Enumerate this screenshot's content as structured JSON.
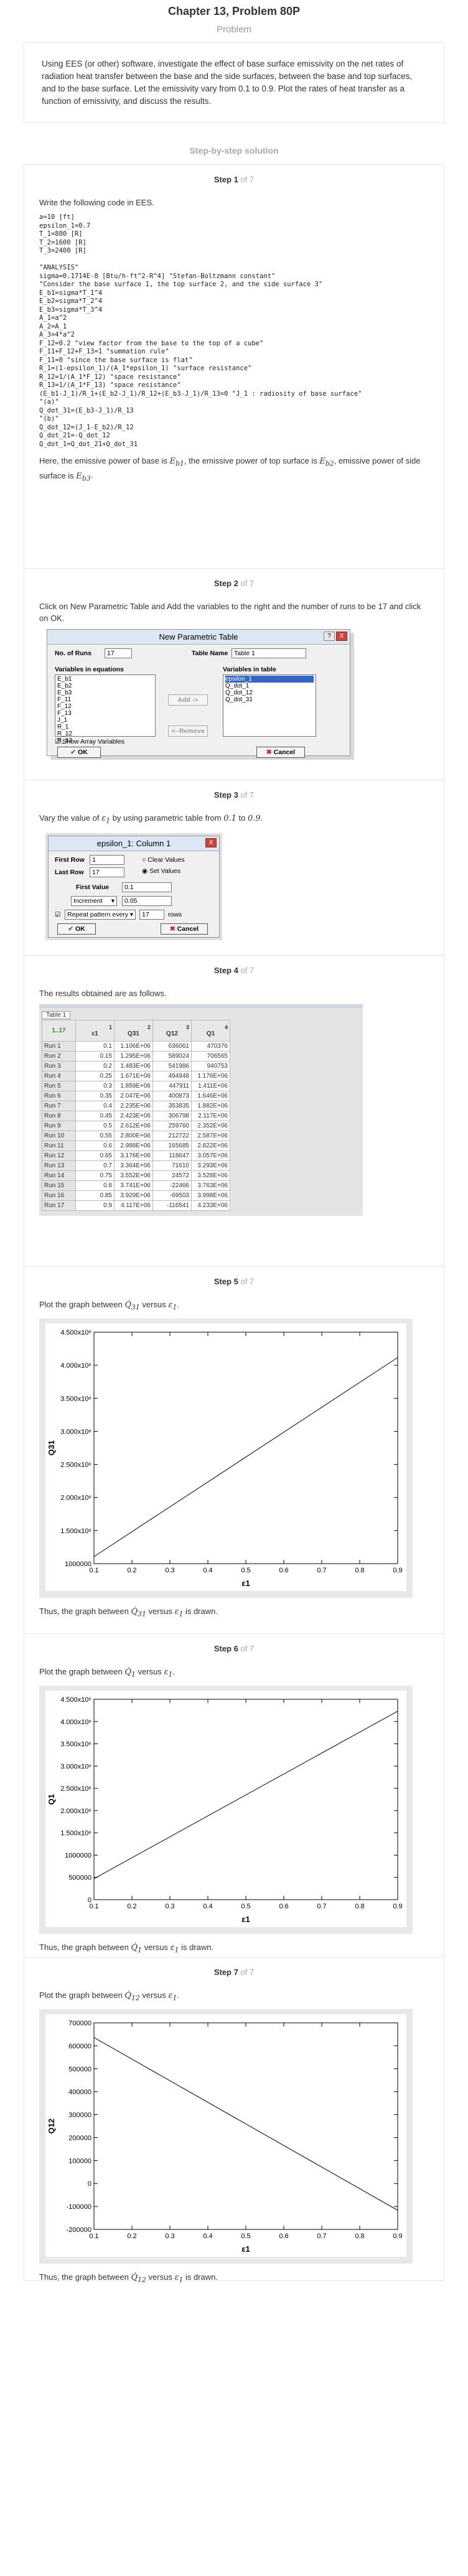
{
  "header": {
    "chapter_title": "Chapter 13, Problem 80P",
    "problem_label": "Problem",
    "problem_text": "Using EES (or other) software, investigate the effect of base surface emissivity on the net rates of radiation heat transfer between the base and the side surfaces, between the base and top surfaces, and to the base surface. Let the emissivity vary from 0.1 to 0.9. Plot the rates of heat transfer as a function of emissivity, and discuss the results.",
    "sbs_title": "Step-by-step solution"
  },
  "steps": {
    "s1": {
      "title": "Step 1",
      "of": "of 7",
      "intro": "Write the following code in EES.",
      "code": "a=10 [ft]\nepsilon_1=0.7\nT_1=800 [R]\nT_2=1600 [R]\nT_3=2400 [R]\n\n\"ANALYSIS\"\nsigma=0.1714E-8 [Btu/h-ft^2-R^4] \"Stefan-Boltzmann constant\"\n\"Consider the base surface 1, the top surface 2, and the side surface 3\"\nE_b1=sigma*T_1^4\nE_b2=sigma*T_2^4\nE_b3=sigma*T_3^4\nA_1=a^2\nA_2=A_1\nA_3=4*a^2\nF_12=0.2 \"view factor from the base to the top of a cube\"\nF_11+F_12+F_13=1 \"summation rule\"\nF_11=0 \"since the base surface is flat\"\nR_1=(1-epsilon_1)/(A_1*epsilon_1) \"surface resistance\"\nR_12=1/(A_1*F_12) \"space resistance\"\nR_13=1/(A_1*F_13) \"space resistance\"\n(E_b1-J_1)/R_1+(E_b2-J_1)/R_12+(E_b3-J_1)/R_13=0 \"J_1 : radiosity of base surface\"\n\"(a)\"\nQ_dot_31=(E_b3-J_1)/R_13\n\"(b)\"\nQ_dot_12=(J_1-E_b2)/R_12\nQ_dot_21=-Q_dot_12\nQ_dot_1=Q_dot_21+Q_dot_31",
      "outro_prefix": "Here, the emissive power of base is",
      "sym_eb1": "E",
      "sub_eb1": "b1",
      "outro_mid1": ", the emissive power of top surface is",
      "sym_eb2": "E",
      "sub_eb2": "b2",
      "outro_mid2": ", emissive power of side surface is",
      "sym_eb3": "E",
      "sub_eb3": "b3",
      "outro_end": "."
    },
    "s2": {
      "title": "Step 2",
      "of": "of 7",
      "text": "Click on New Parametric Table and Add the variables to the right and the number of runs to be 17 and click on OK.",
      "dialog": {
        "title": "New Parametric Table",
        "runs_label": "No. of Runs",
        "runs_value": "17",
        "table_name_label": "Table Name",
        "table_name_value": "Table 1",
        "vars_eq_label": "Variables in equations",
        "vars_eq": [
          "E_b1",
          "E_b2",
          "E_b3",
          "F_11",
          "F_12",
          "F_13",
          "J_1",
          "R_1",
          "R_12",
          "R_13"
        ],
        "vars_tbl_label": "Variables in table",
        "vars_tbl": [
          "epsilon_1",
          "Q_dot_1",
          "Q_dot_12",
          "Q_dot_31"
        ],
        "add_label": "Add ->",
        "remove_label": "<- Remove",
        "show_array": "Show Array Variables",
        "ok_label": "OK",
        "cancel_label": "Cancel",
        "help_label": "?",
        "close_label": "X"
      }
    },
    "s3": {
      "title": "Step 3",
      "of": "of 7",
      "text_prefix": "Vary the value of",
      "sym": "ε",
      "sub": "1",
      "text_mid": "by using parametric table from",
      "from": "0.1",
      "to_word": "to",
      "to": "0.9",
      "text_end": ".",
      "dialog": {
        "title": "epsilon_1: Column 1",
        "first_row_label": "First Row",
        "first_row": "1",
        "last_row_label": "Last Row",
        "last_row": "17",
        "clear_values": "Clear Values",
        "set_values": "Set Values",
        "first_value_label": "First Value",
        "first_value": "0.1",
        "mode": "Increment",
        "increment": "0.05",
        "repeat_label": "Repeat pattern every",
        "repeat_value": "17",
        "rows_label": "rows",
        "ok_label": "OK",
        "cancel_label": "Cancel",
        "close_label": "X"
      }
    },
    "s4": {
      "title": "Step 4",
      "of": "of 7",
      "text": "The results obtained are as follows.",
      "table_tab": "Table 1",
      "corner": "1..17",
      "col_headers": [
        "ε1",
        "Q31",
        "Q12",
        "Q1"
      ],
      "col_index": [
        "1",
        "2",
        "3",
        "4"
      ],
      "rows": [
        [
          "Run 1",
          "0.1",
          "1.106E+06",
          "636061",
          "470376"
        ],
        [
          "Run 2",
          "0.15",
          "1.295E+06",
          "589024",
          "706565"
        ],
        [
          "Run 3",
          "0.2",
          "1.483E+06",
          "541986",
          "940753"
        ],
        [
          "Run 4",
          "0.25",
          "1.671E+06",
          "494948",
          "1.176E+06"
        ],
        [
          "Run 5",
          "0.3",
          "1.859E+06",
          "447911",
          "1.411E+06"
        ],
        [
          "Run 6",
          "0.35",
          "2.047E+06",
          "400873",
          "1.646E+06"
        ],
        [
          "Run 7",
          "0.4",
          "2.235E+06",
          "353835",
          "1.882E+06"
        ],
        [
          "Run 8",
          "0.45",
          "2.423E+06",
          "306798",
          "2.117E+06"
        ],
        [
          "Run 9",
          "0.5",
          "2.612E+06",
          "259760",
          "2.352E+06"
        ],
        [
          "Run 10",
          "0.55",
          "2.800E+06",
          "212722",
          "2.587E+06"
        ],
        [
          "Run 11",
          "0.6",
          "2.988E+06",
          "165685",
          "2.822E+06"
        ],
        [
          "Run 12",
          "0.65",
          "3.176E+06",
          "118647",
          "3.057E+06"
        ],
        [
          "Run 13",
          "0.7",
          "3.364E+06",
          "71610",
          "3.293E+06"
        ],
        [
          "Run 14",
          "0.75",
          "3.552E+06",
          "24572",
          "3.528E+06"
        ],
        [
          "Run 15",
          "0.8",
          "3.741E+06",
          "-22466",
          "3.763E+06"
        ],
        [
          "Run 16",
          "0.85",
          "3.929E+06",
          "-69503",
          "3.998E+06"
        ],
        [
          "Run 17",
          "0.9",
          "4.117E+06",
          "-116541",
          "4.233E+06"
        ]
      ]
    },
    "s5": {
      "title": "Step 5",
      "of": "of 7",
      "text_prefix": "Plot the graph between",
      "text_mid": "versus",
      "sym": "ε",
      "sub": "1",
      "text_end": ".",
      "outro_prefix": "Thus, the graph between",
      "outro_mid": "versus",
      "outro_end": "is drawn."
    },
    "s6": {
      "title": "Step 6",
      "of": "of 7",
      "text_prefix": "Plot the graph between",
      "text_mid": "versus",
      "sym": "ε",
      "sub": "1",
      "text_end": ".",
      "outro_prefix": "Thus, the graph between",
      "outro_mid": "versus",
      "outro_end": "is drawn."
    },
    "s7": {
      "title": "Step 7",
      "of": "of 7",
      "text_prefix": "Plot the graph between",
      "text_mid": "versus",
      "sym": "ε",
      "sub": "1",
      "text_end": ".",
      "outro_prefix": "Thus, the graph between",
      "outro_mid": "versus",
      "outro_end": "is drawn."
    }
  },
  "chart_data": [
    {
      "type": "line",
      "xlabel": "ε1",
      "ylabel": "Q31",
      "xlim": [
        0.1,
        0.9
      ],
      "ylim": [
        1000000,
        4500000
      ],
      "xticks": [
        "0.1",
        "0.2",
        "0.3",
        "0.4",
        "0.5",
        "0.6",
        "0.7",
        "0.8",
        "0.9"
      ],
      "yticks": [
        "1000000",
        "1.500x10⁶",
        "2.000x10⁶",
        "2.500x10⁶",
        "3.000x10⁶",
        "3.500x10⁶",
        "4.000x10⁶",
        "4.500x10⁶"
      ],
      "ytick_values": [
        1000000,
        1500000,
        2000000,
        2500000,
        3000000,
        3500000,
        4000000,
        4500000
      ],
      "x": [
        0.1,
        0.9
      ],
      "y": [
        1106000,
        4117000
      ],
      "grid": false
    },
    {
      "type": "line",
      "xlabel": "ε1",
      "ylabel": "Q1",
      "xlim": [
        0.1,
        0.9
      ],
      "ylim": [
        0,
        4500000
      ],
      "xticks": [
        "0.1",
        "0.2",
        "0.3",
        "0.4",
        "0.5",
        "0.6",
        "0.7",
        "0.8",
        "0.9"
      ],
      "yticks": [
        "0",
        "500000",
        "1000000",
        "1.500x10⁶",
        "2.000x10⁶",
        "2.500x10⁶",
        "3.000x10⁶",
        "3.500x10⁶",
        "4.000x10⁶",
        "4.500x10⁶"
      ],
      "ytick_values": [
        0,
        500000,
        1000000,
        1500000,
        2000000,
        2500000,
        3000000,
        3500000,
        4000000,
        4500000
      ],
      "x": [
        0.1,
        0.9
      ],
      "y": [
        470376,
        4233000
      ],
      "grid": false
    },
    {
      "type": "line",
      "xlabel": "ε1",
      "ylabel": "Q12",
      "xlim": [
        0.1,
        0.9
      ],
      "ylim": [
        -200000,
        700000
      ],
      "xticks": [
        "0.1",
        "0.2",
        "0.3",
        "0.4",
        "0.5",
        "0.6",
        "0.7",
        "0.8",
        "0.9"
      ],
      "yticks": [
        "-200000",
        "-100000",
        "0",
        "100000",
        "200000",
        "300000",
        "400000",
        "500000",
        "600000",
        "700000"
      ],
      "ytick_values": [
        -200000,
        -100000,
        0,
        100000,
        200000,
        300000,
        400000,
        500000,
        600000,
        700000
      ],
      "x": [
        0.1,
        0.9
      ],
      "y": [
        636061,
        -116541
      ],
      "grid": false
    }
  ]
}
